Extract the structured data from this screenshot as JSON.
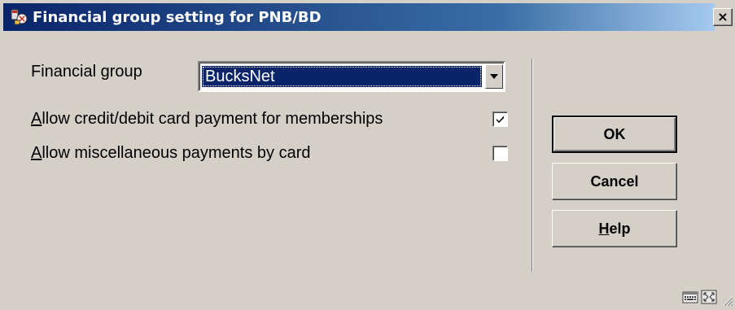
{
  "window": {
    "title": "Financial group setting for PNB/BD",
    "close_label": "×"
  },
  "form": {
    "financial_group_label": "Financial group",
    "financial_group_value": "BucksNet",
    "allow_card_memberships": {
      "label_accel": "A",
      "label_rest": "llow credit/debit card payment for memberships",
      "checked": true
    },
    "allow_misc_card": {
      "label_accel": "A",
      "label_rest": "llow miscellaneous payments by card",
      "checked": false
    }
  },
  "buttons": {
    "ok": "OK",
    "cancel": "Cancel",
    "help_accel": "H",
    "help_rest": "elp"
  },
  "colors": {
    "titlebar_start": "#0a246a",
    "titlebar_end": "#a6caf0",
    "face": "#d4d0c8",
    "selection": "#0a246a"
  },
  "icons": [
    "app-icon",
    "close-icon",
    "dropdown-arrow-icon",
    "checkmark-icon",
    "keyboard-icon",
    "resize-window-icon",
    "size-grip-icon"
  ]
}
